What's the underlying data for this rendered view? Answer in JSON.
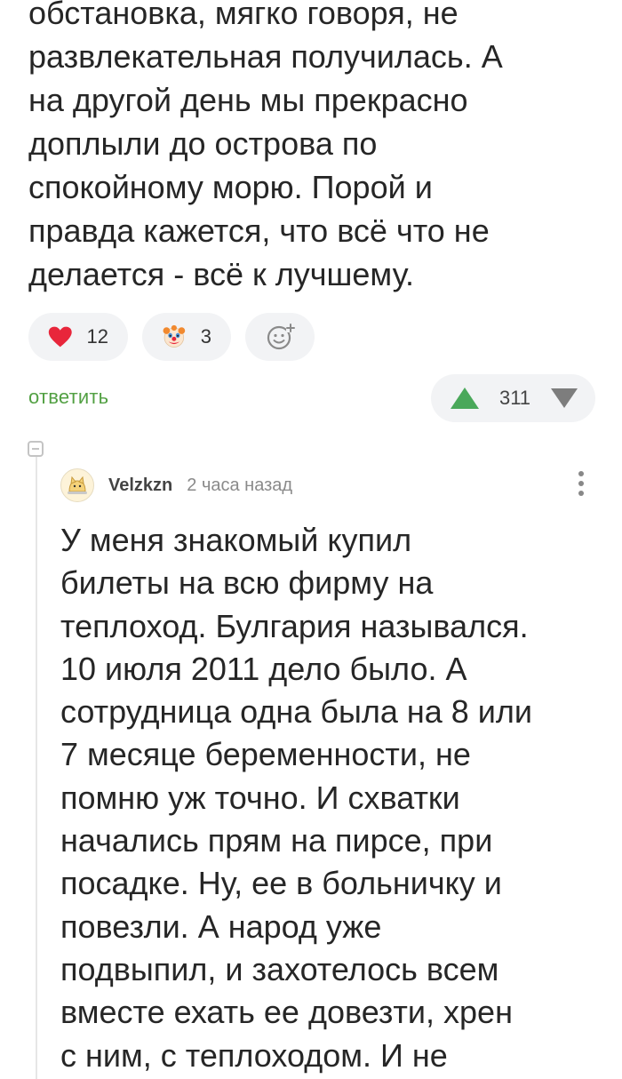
{
  "post_text_lines": [
    "обстановка, мягко говоря, не",
    "развлекательная получилась. А",
    "на другой день мы прекрасно",
    "доплыли до острова по",
    "спокойному морю. Порой и",
    "правда кажется, что всё что не",
    "делается - всё к лучшему."
  ],
  "reactions": {
    "heart_count": "12",
    "clown_count": "3",
    "heart_color": "#e8263b"
  },
  "actions": {
    "reply_label": "ответить"
  },
  "rating": {
    "value": "311",
    "up_color": "#4aa85a",
    "down_color": "#7d7d7d"
  },
  "comment": {
    "author": "Velzkzn",
    "time": "2 часа назад",
    "text_lines": [
      "У меня знакомый купил",
      "билеты на всю фирму на",
      "теплоход. Булгария назывался.",
      "10 июля 2011 дело было. А",
      "сотрудница одна была на 8 или",
      "7 месяце беременности, не",
      "помню уж точно. И схватки",
      "начались прям на пирсе, при",
      "посадке. Ну, ее в больничку и",
      "повезли. А народ уже",
      "подвыпил, и захотелось всем",
      "вместе ехать ее довезти, хрен",
      "с ним, с теплоходом. И не"
    ]
  }
}
